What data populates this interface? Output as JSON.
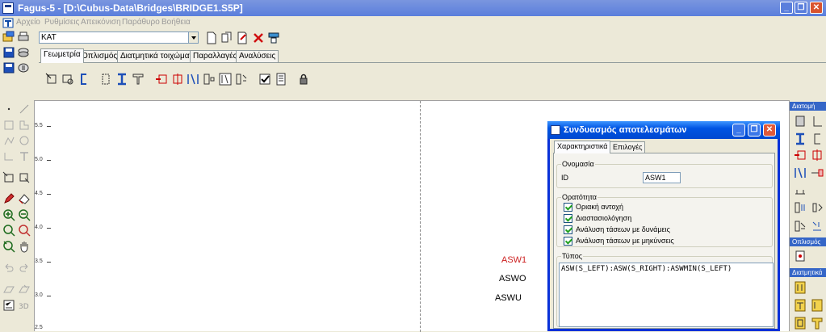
{
  "window": {
    "title": "Fagus-5 - [D:\\Cubus-Data\\Bridges\\BRIDGE1.S5P]",
    "controls": [
      "_",
      "❐",
      "✕"
    ]
  },
  "menu": {
    "items": [
      "Αρχείο",
      "Ρυθμίσεις",
      "Απεικόνιση",
      "Παράθυρο",
      "Βοήθεια"
    ]
  },
  "combo": {
    "value": "KAT"
  },
  "tabs": [
    "Γεωμετρία",
    "Οπλισμός",
    "Διατμητικά τοιχώματα",
    "Παραλλαγές",
    "Αναλύσεις"
  ],
  "ruler": {
    "labels": [
      "5.5",
      "5.0",
      "4.5",
      "4.0",
      "3.5",
      "3.0",
      "2.5"
    ]
  },
  "canvas": {
    "labels": [
      "ASW1",
      "ASWO",
      "ASWU"
    ],
    "highlight_color": "#cc1f1f"
  },
  "right_panel": {
    "sections": [
      "Διατομή",
      "Οπλισμός",
      "Διατμητικά"
    ]
  },
  "dialog": {
    "title": "Συνδυασμός αποτελεσμάτων",
    "tabs": [
      "Χαρακτηριστικά",
      "Επιλογές"
    ],
    "name_group": {
      "label": "Ονομασία",
      "id_label": "ID",
      "id_value": "ASW1"
    },
    "visibility_group": {
      "label": "Ορατότητα",
      "items": [
        "Οριακή αντοχή",
        "Διαστασιολόγηση",
        "Ανάλυση τάσεων με δυνάμεις",
        "Ανάλυση τάσεων με μηκύνσεις"
      ]
    },
    "type_group": {
      "label": "Τύπος",
      "expression": "ASW(S_LEFT):ASW(S_RIGHT):ASWMIN(S_LEFT)"
    }
  },
  "colors": {
    "titlebar": "#5a7edc",
    "dialog_titlebar": "#0054e3",
    "canvas": "#ffffff"
  }
}
